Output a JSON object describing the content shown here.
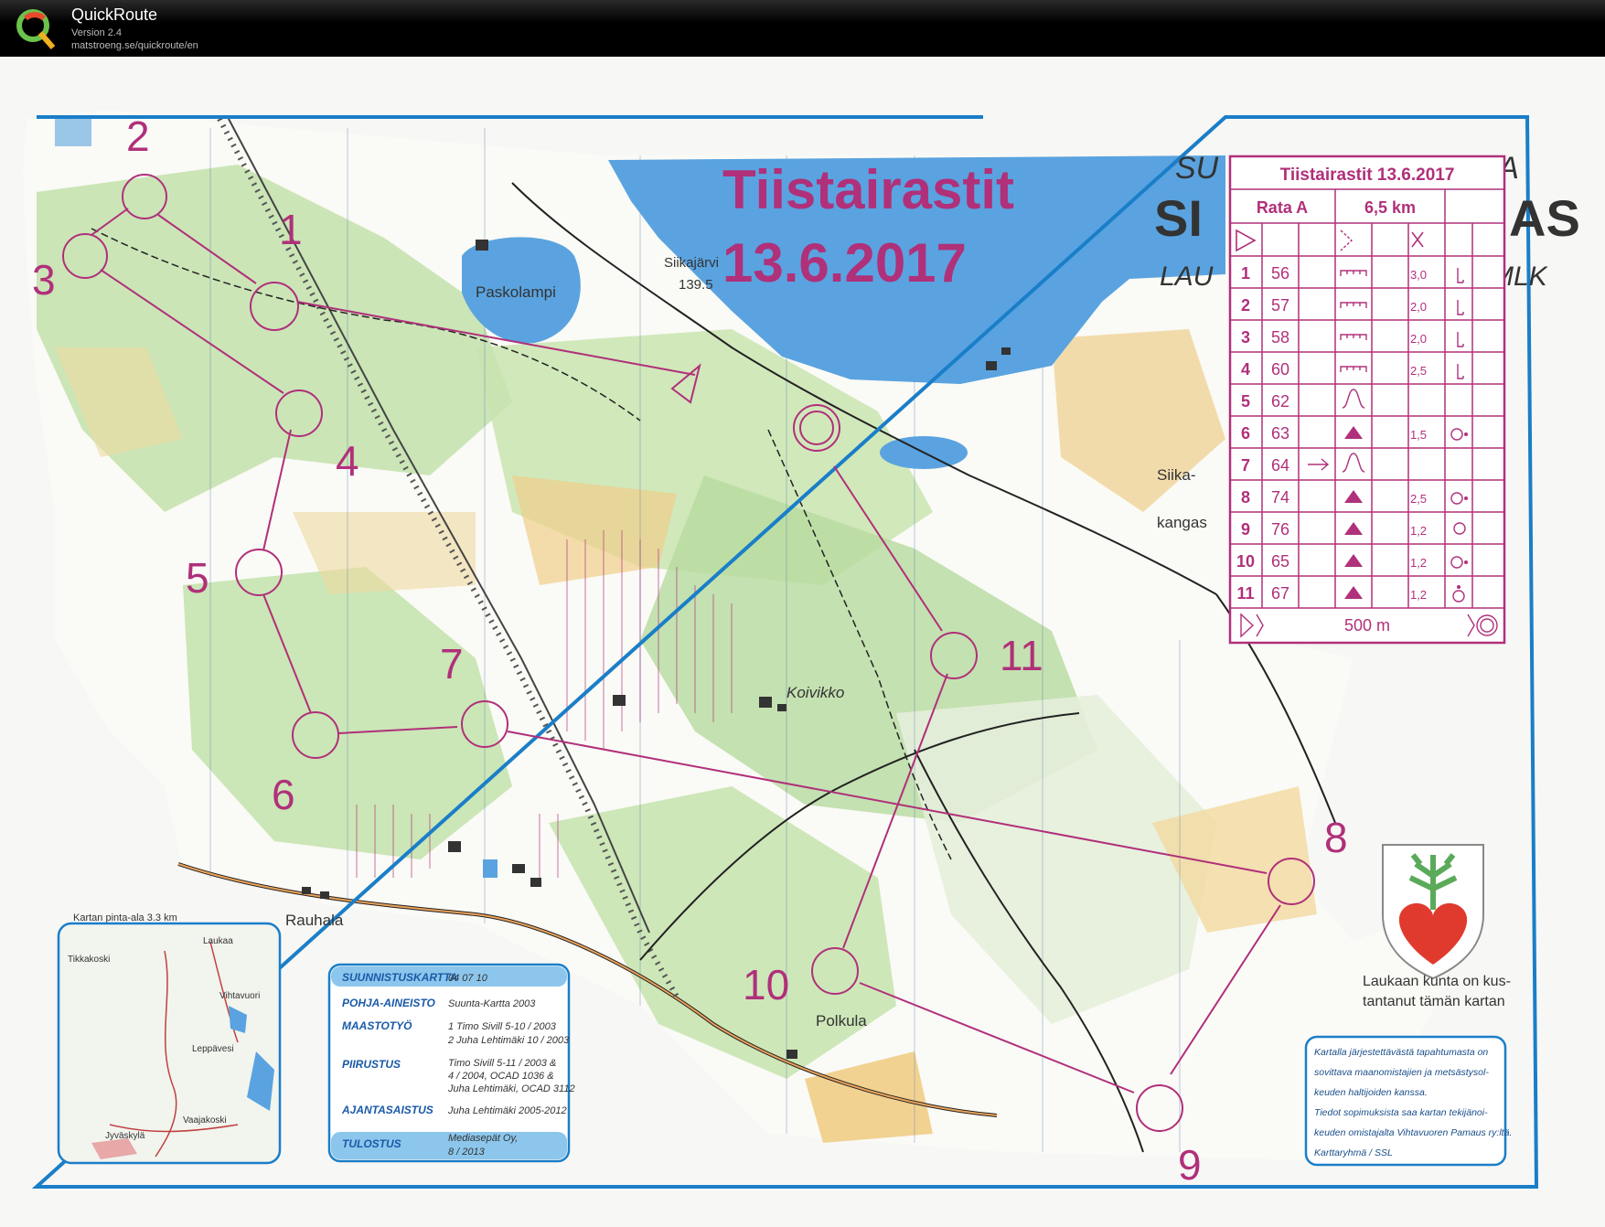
{
  "app": {
    "name": "QuickRoute",
    "version": "Version 2.4",
    "url": "matstroeng.se/quickroute/en"
  },
  "map": {
    "event_title_1": "Tiistairastit",
    "event_title_2": "13.6.2017",
    "bg_title_1": "SU",
    "bg_title_1b": "TA",
    "bg_title_2": "SI",
    "bg_title_2b": "AS",
    "bg_title_3": "LAU",
    "bg_title_3b": "MLK",
    "place_names": [
      "Paskolampi",
      "Siikajärvi",
      "139.5",
      "Siika-",
      "kangas",
      "Koivikko",
      "Rauhala",
      "Polkula"
    ],
    "control_numbers": [
      "1",
      "2",
      "3",
      "4",
      "5",
      "6",
      "7",
      "8",
      "9",
      "10",
      "11"
    ],
    "municipality_text_1": "Laukaan kunta on kus-",
    "municipality_text_2": "tantanut tämän kartan",
    "notice_lines": [
      "Kartalla järjestettävästä tapahtumasta on",
      "sovittava maanomistajien ja metsästysol-",
      "keuden haltijoiden kanssa.",
      "Tiedot sopimuksista saa kartan tekijänoi-",
      "keuden omistajalta Vihtavuoren Pamaus ry:ltä.",
      "Karttaryhmä / SSL"
    ],
    "inset_title": "Kartan pinta-ala 3.3 km",
    "inset_places": [
      "Tikkakoski",
      "Laukaa",
      "Vihtavuori",
      "Leppävesi",
      "Jyväskylä",
      "Vaajakoski"
    ],
    "credits": [
      {
        "label": "SUUNNISTUSKARTTA",
        "value": "04 07 10"
      },
      {
        "label": "POHJA-AINEISTO",
        "value": "Suunta-Kartta  2003"
      },
      {
        "label": "MAASTOTYÖ",
        "value": "1 Timo Sivill  5-10 / 2003"
      },
      {
        "label": "",
        "value": "2 Juha Lehtimäki  10 / 2003"
      },
      {
        "label": "PIIRUSTUS",
        "value": "Timo Sivill  5-11 / 2003 &"
      },
      {
        "label": "",
        "value": "4 / 2004,  OCAD 1036  &"
      },
      {
        "label": "",
        "value": "Juha Lehtimäki, OCAD 3112"
      },
      {
        "label": "AJANTASAISTUS",
        "value": "Juha Lehtimäki  2005-2012"
      },
      {
        "label": "TULOSTUS",
        "value": "Mediasepät Oy,"
      },
      {
        "label": "",
        "value": "8 / 2013"
      }
    ]
  },
  "description_sheet": {
    "title": "Tiistairastit 13.6.2017",
    "course": "Rata A",
    "length": "6,5 km",
    "rows": [
      {
        "n": "1",
        "code": "56",
        "dim": "3,0"
      },
      {
        "n": "2",
        "code": "57",
        "dim": "2,0"
      },
      {
        "n": "3",
        "code": "58",
        "dim": "2,0"
      },
      {
        "n": "4",
        "code": "60",
        "dim": "2,5"
      },
      {
        "n": "5",
        "code": "62",
        "dim": ""
      },
      {
        "n": "6",
        "code": "63",
        "dim": "1,5"
      },
      {
        "n": "7",
        "code": "64",
        "dim": ""
      },
      {
        "n": "8",
        "code": "74",
        "dim": "2,5"
      },
      {
        "n": "9",
        "code": "76",
        "dim": "1,2"
      },
      {
        "n": "10",
        "code": "65",
        "dim": "1,2"
      },
      {
        "n": "11",
        "code": "67",
        "dim": "1,2"
      }
    ],
    "finish_distance": "500 m"
  },
  "colors": {
    "course": "#b0307a",
    "water": "#5aa3e0",
    "forest_green": "#a8d08d",
    "open_yellow": "#f0c878",
    "frame_blue": "#1a7ec8"
  }
}
